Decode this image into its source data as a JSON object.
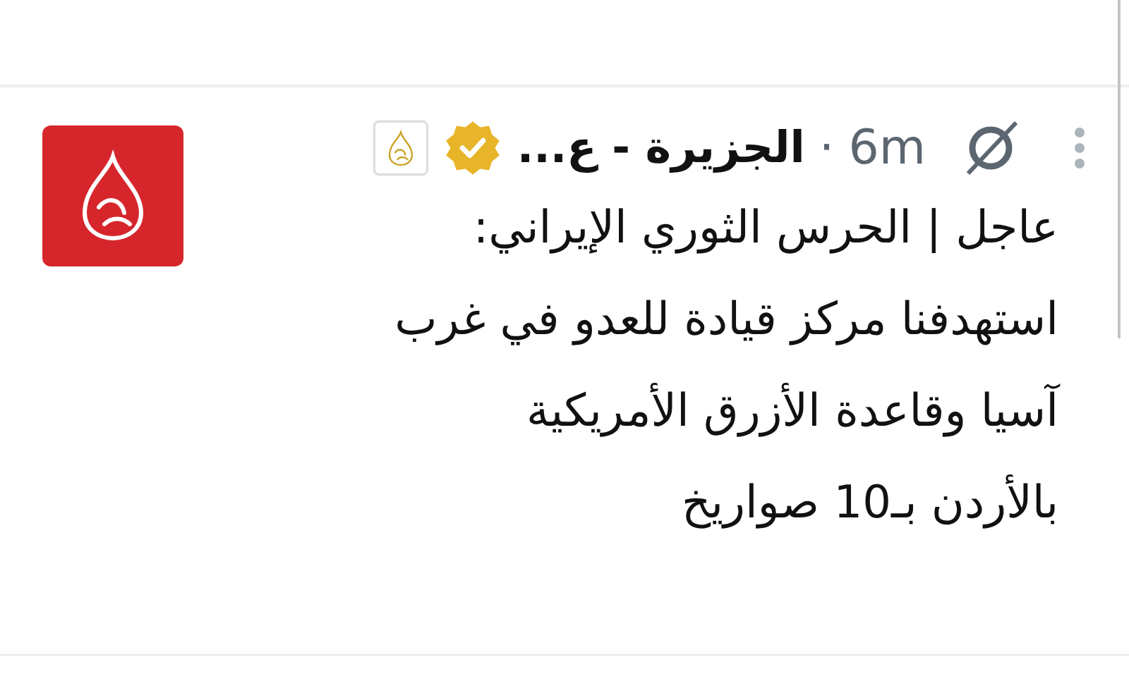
{
  "tweet": {
    "author": "الجزيرة - ع...",
    "verified": true,
    "time": "6m",
    "separator": "·",
    "lines": [
      "عاجل | الحرس الثوري الإيراني:",
      "استهدفنا مركز قيادة للعدو في غرب",
      "آسيا وقاعدة الأزرق الأمريكية",
      "بالأردن بـ10 صواريخ"
    ]
  }
}
